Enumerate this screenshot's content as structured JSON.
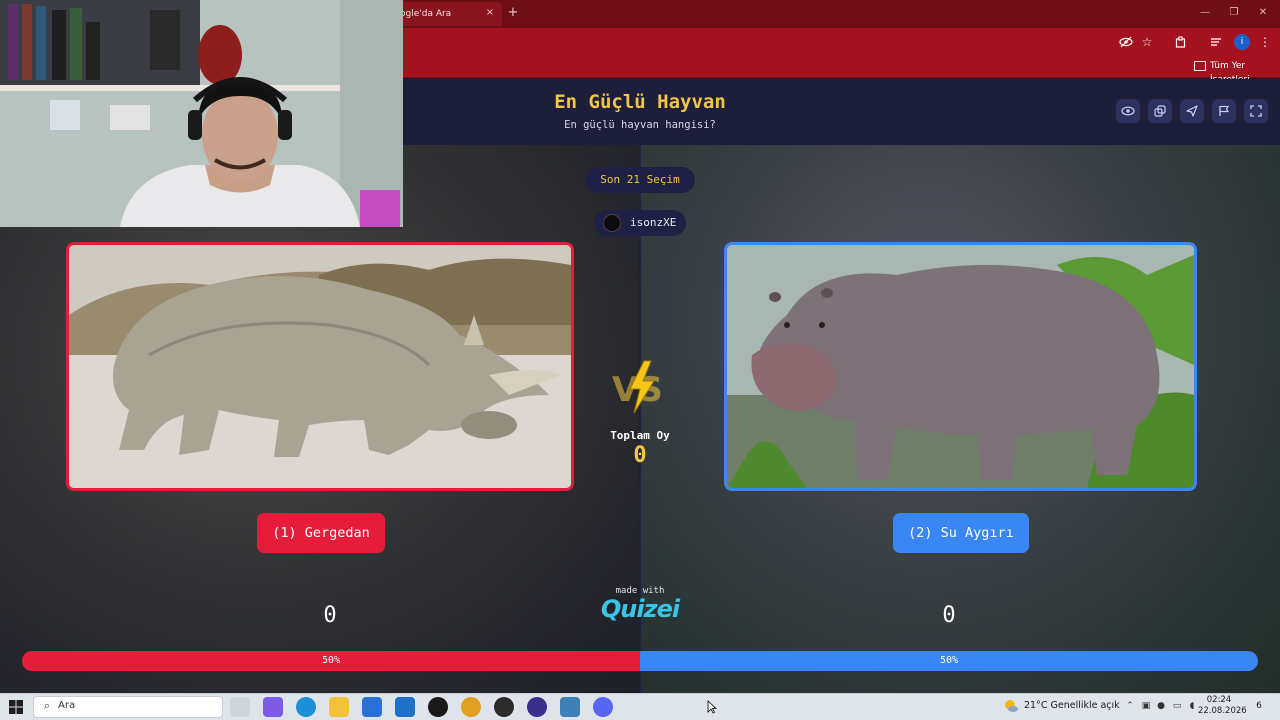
{
  "browser": {
    "tab_title": "ogle'da Ara",
    "tab_close": "×",
    "new_tab": "+",
    "window_controls": [
      "—",
      "❐",
      "✕"
    ],
    "toolbar_icons": [
      "eye-off-icon",
      "star-icon",
      "extensions-icon",
      "reading-list-icon",
      "profile-icon",
      "menu-icon"
    ],
    "profile_initial": "i",
    "bookmarks_label": "Tüm Yer İşaretleri"
  },
  "quiz": {
    "title": "En Güçlü Hayvan",
    "subtitle": "En güçlü hayvan hangisi?",
    "header_buttons": [
      "eye-icon",
      "duplicate-icon",
      "send-icon",
      "flag-icon",
      "fullscreen-icon"
    ],
    "recent_pill": "Son 21 Seçim",
    "user": "isonzXE",
    "total_label": "Toplam Oy",
    "total_votes": "0",
    "made_with": "made with",
    "brand": "Quizei",
    "left": {
      "choice_label": "(1) Gergedan",
      "votes": "0",
      "percent_label": "50%",
      "percent": 0.5,
      "accent": "#e51d3a"
    },
    "right": {
      "choice_label": "(2) Su Aygırı",
      "votes": "0",
      "percent_label": "50%",
      "percent": 0.5,
      "accent": "#3a86f5"
    }
  },
  "taskbar": {
    "search_placeholder": "Ara",
    "weather": "21°C  Genellikle açık",
    "time": "02:24",
    "date": "22.08.2026",
    "notification_count": "6"
  },
  "colors": {
    "title_yellow": "#f2c641",
    "header_navy": "#1d1f3a",
    "chrome_red": "#a3121e"
  }
}
